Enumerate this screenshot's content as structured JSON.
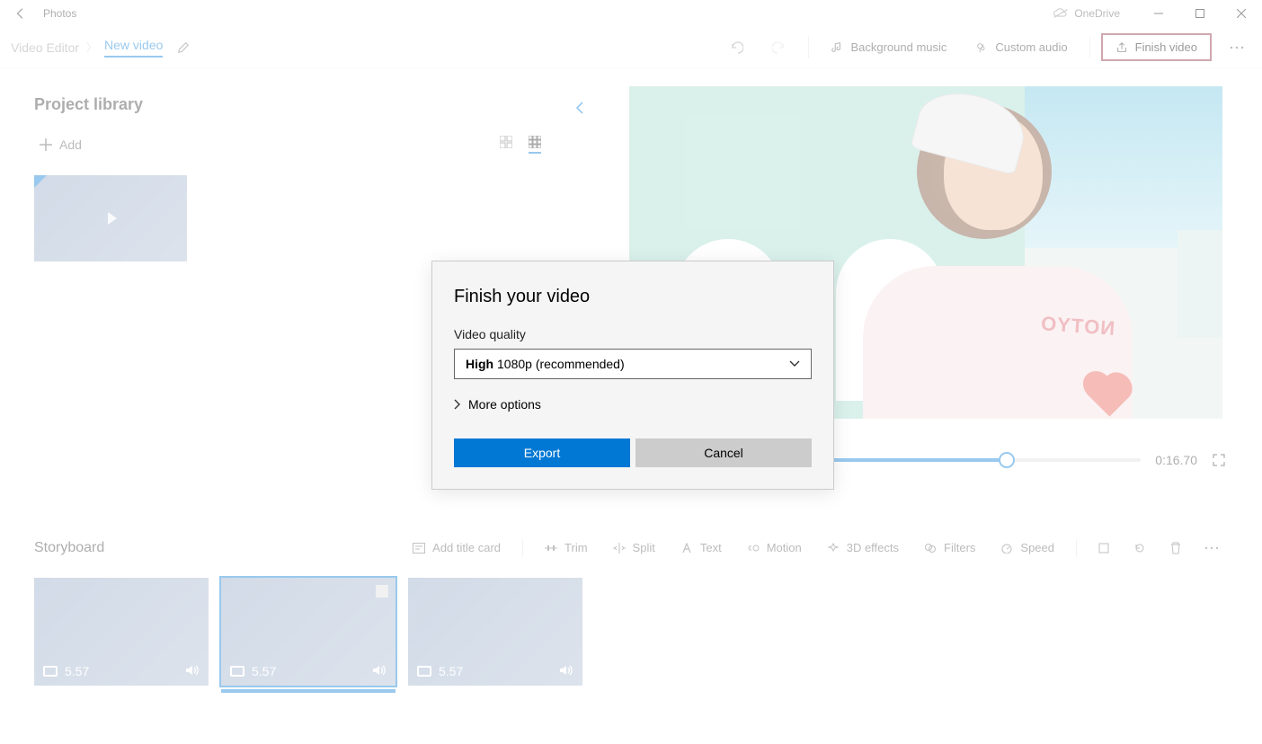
{
  "titleBar": {
    "appTitle": "Photos",
    "oneDrive": "OneDrive"
  },
  "toolbar": {
    "videoEditor": "Video Editor",
    "projectName": "New video",
    "backgroundMusic": "Background music",
    "customAudio": "Custom audio",
    "finishVideo": "Finish video"
  },
  "library": {
    "title": "Project library",
    "addLabel": "Add"
  },
  "preview": {
    "jacketText": "NOTYO",
    "duration": "0:16.70"
  },
  "storyboard": {
    "title": "Storyboard",
    "addTitleCard": "Add title card",
    "trim": "Trim",
    "split": "Split",
    "text": "Text",
    "motion": "Motion",
    "effects3d": "3D effects",
    "filters": "Filters",
    "speed": "Speed",
    "clips": [
      {
        "duration": "5.57"
      },
      {
        "duration": "5.57"
      },
      {
        "duration": "5.57"
      }
    ]
  },
  "dialog": {
    "title": "Finish your video",
    "qualityLabel": "Video quality",
    "qualityBold": "High",
    "qualityRest": " 1080p (recommended)",
    "moreOptions": "More options",
    "export": "Export",
    "cancel": "Cancel"
  }
}
